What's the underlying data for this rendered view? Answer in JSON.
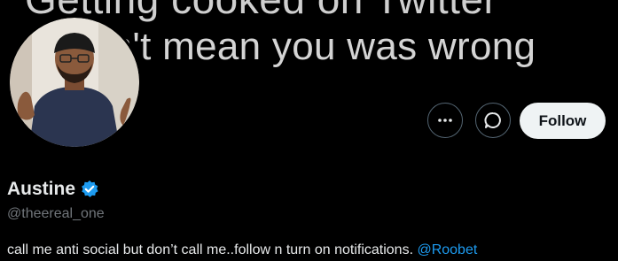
{
  "banner": {
    "line1": "Getting cooked on Twitter",
    "line2": "doesn't mean you was wrong"
  },
  "actions": {
    "more_icon": "more-horizontal-icon",
    "message_icon": "message-bubble-icon",
    "follow_label": "Follow"
  },
  "profile": {
    "display_name": "Austine",
    "verified_icon": "verified-badge-icon",
    "handle": "@theereal_one",
    "bio_text": "call me anti social but don’t call me..follow n turn on notifications. ",
    "bio_mention": "@Roobet"
  },
  "colors": {
    "background": "#000000",
    "text_primary": "#e7e9ea",
    "text_secondary": "#71767b",
    "link": "#1d9bf0",
    "verified": "#1d9bf0",
    "follow_button_bg": "#eff3f4"
  }
}
